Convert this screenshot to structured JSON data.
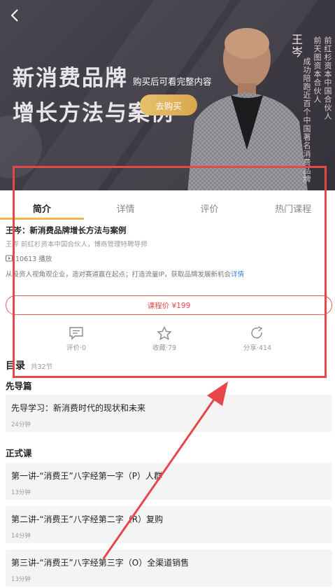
{
  "hero": {
    "title_line1": "新消费品牌",
    "title_line2": "增长方法与案例",
    "teacher_name": "王岑",
    "vertical_col1": "前红杉资本中国合伙人",
    "vertical_col2": "前天图资本合伙人",
    "vertical_col3": "成功陪跑近百个中国著名消费品牌",
    "purchase_tip": "购买后可看完整内容",
    "buy_label": "去购买"
  },
  "tabs": [
    {
      "label": "简介",
      "active": true
    },
    {
      "label": "详情",
      "active": false
    },
    {
      "label": "评价",
      "active": false
    },
    {
      "label": "热门课程",
      "active": false
    }
  ],
  "course": {
    "title": "王岑：新消费品牌增长方法与案例",
    "subtitle": "王岑 前红杉资本中国合伙人，博商管理特聘导师",
    "plays": "10613 播放",
    "description": "从投资人视角观企业，造对赛道赢在起点；打造流量IP，获取品牌发展新机会",
    "more_label": "详情"
  },
  "price": {
    "label": "课程价 ¥199"
  },
  "actions": {
    "review": "评价·0",
    "favorite": "收藏·79",
    "share": "分享·414"
  },
  "catalog": {
    "title": "目录",
    "count": "共32节",
    "section1": "先导篇",
    "section2": "正式课",
    "lessons": [
      {
        "title": "先导学习：新消费时代的现状和未来",
        "duration": "24分钟"
      },
      {
        "title": "第一讲-“消费王”八字经第一字（P）人群",
        "duration": "13分钟"
      },
      {
        "title": "第二讲-“消费王”八字经第二字（R）复购",
        "duration": "14分钟"
      },
      {
        "title": "第三讲-“消费王”八字经第三字（O）全渠道销售",
        "duration": "13分钟"
      }
    ]
  },
  "colors": {
    "accent": "#f2b84b",
    "price": "#e44a4a",
    "annotation": "#e8474a",
    "link": "#3a82d6"
  }
}
